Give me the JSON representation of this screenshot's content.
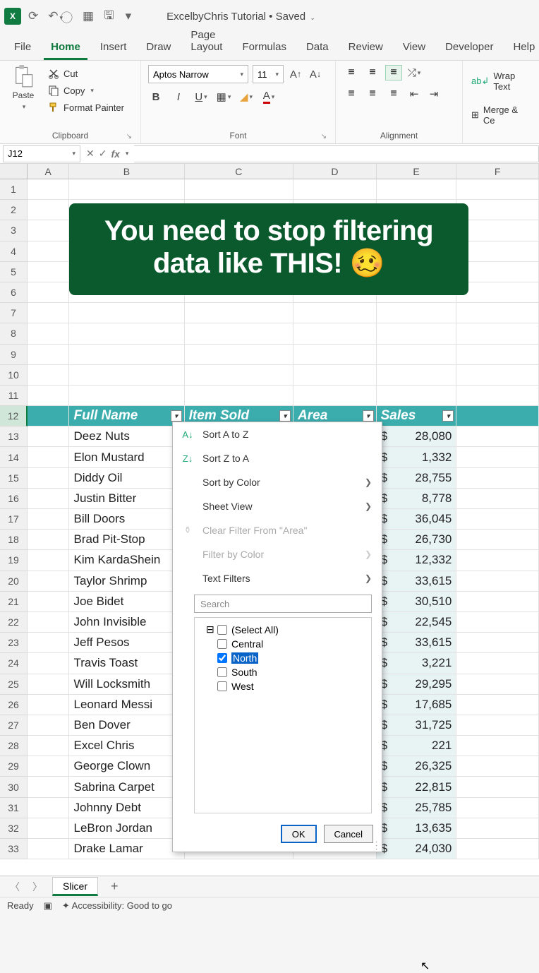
{
  "title": {
    "doc": "ExcelbyChris Tutorial",
    "state": "Saved"
  },
  "tabs": [
    "File",
    "Home",
    "Insert",
    "Draw",
    "Page Layout",
    "Formulas",
    "Data",
    "Review",
    "View",
    "Developer",
    "Help"
  ],
  "active_tab": "Home",
  "clipboard": {
    "paste": "Paste",
    "cut": "Cut",
    "copy": "Copy",
    "format_painter": "Format Painter",
    "group": "Clipboard"
  },
  "font": {
    "name": "Aptos Narrow",
    "size": "11",
    "group": "Font"
  },
  "alignment": {
    "wrap": "Wrap Text",
    "merge": "Merge & Ce",
    "group": "Alignment"
  },
  "namebox": "J12",
  "columns": [
    "A",
    "B",
    "C",
    "D",
    "E",
    "F"
  ],
  "colClasses": [
    "cA",
    "cB",
    "cC",
    "cD",
    "cE",
    "cF"
  ],
  "rows_start": 1,
  "rows_end": 33,
  "active_row": 12,
  "headers": {
    "b": "Full Name",
    "c": "Item Sold",
    "d": "Area",
    "e": "Sales"
  },
  "banner_text": "You need to stop filtering data like THIS! 🥴",
  "data_rows": [
    {
      "r": 13,
      "name": "Deez Nuts",
      "sale": "28,080"
    },
    {
      "r": 14,
      "name": "Elon Mustard",
      "sale": "1,332"
    },
    {
      "r": 15,
      "name": "Diddy Oil",
      "sale": "28,755"
    },
    {
      "r": 16,
      "name": "Justin Bitter",
      "sale": "8,778"
    },
    {
      "r": 17,
      "name": "Bill Doors",
      "sale": "36,045"
    },
    {
      "r": 18,
      "name": "Brad Pit-Stop",
      "sale": "26,730"
    },
    {
      "r": 19,
      "name": "Kim KardaShein",
      "sale": "12,332"
    },
    {
      "r": 20,
      "name": "Taylor Shrimp",
      "sale": "33,615"
    },
    {
      "r": 21,
      "name": "Joe Bidet",
      "sale": "30,510"
    },
    {
      "r": 22,
      "name": "John Invisible",
      "sale": "22,545"
    },
    {
      "r": 23,
      "name": "Jeff Pesos",
      "sale": "33,615"
    },
    {
      "r": 24,
      "name": "Travis Toast",
      "sale": "3,221"
    },
    {
      "r": 25,
      "name": "Will Locksmith",
      "sale": "29,295"
    },
    {
      "r": 26,
      "name": "Leonard Messi",
      "sale": "17,685"
    },
    {
      "r": 27,
      "name": "Ben Dover",
      "sale": "31,725"
    },
    {
      "r": 28,
      "name": "Excel Chris",
      "sale": "221"
    },
    {
      "r": 29,
      "name": "George Clown",
      "sale": "26,325"
    },
    {
      "r": 30,
      "name": "Sabrina Carpet",
      "sale": "22,815"
    },
    {
      "r": 31,
      "name": "Johnny Debt",
      "sale": "25,785"
    },
    {
      "r": 32,
      "name": "LeBron Jordan",
      "sale": "13,635"
    },
    {
      "r": 33,
      "name": "Drake Lamar",
      "sale": "24,030"
    }
  ],
  "currency": "$",
  "dropdown": {
    "sort_az": "Sort A to Z",
    "sort_za": "Sort Z to A",
    "sort_color": "Sort by Color",
    "sheet_view": "Sheet View",
    "clear": "Clear Filter From \"Area\"",
    "filter_color": "Filter by Color",
    "text_filters": "Text Filters",
    "search_ph": "Search",
    "select_all": "(Select All)",
    "items": [
      {
        "label": "Central",
        "checked": false,
        "hl": false
      },
      {
        "label": "North",
        "checked": true,
        "hl": true
      },
      {
        "label": "South",
        "checked": false,
        "hl": false
      },
      {
        "label": "West",
        "checked": false,
        "hl": false
      }
    ],
    "ok": "OK",
    "cancel": "Cancel"
  },
  "sheet_tab": "Slicer",
  "status": {
    "ready": "Ready",
    "acc": "Accessibility: Good to go"
  }
}
